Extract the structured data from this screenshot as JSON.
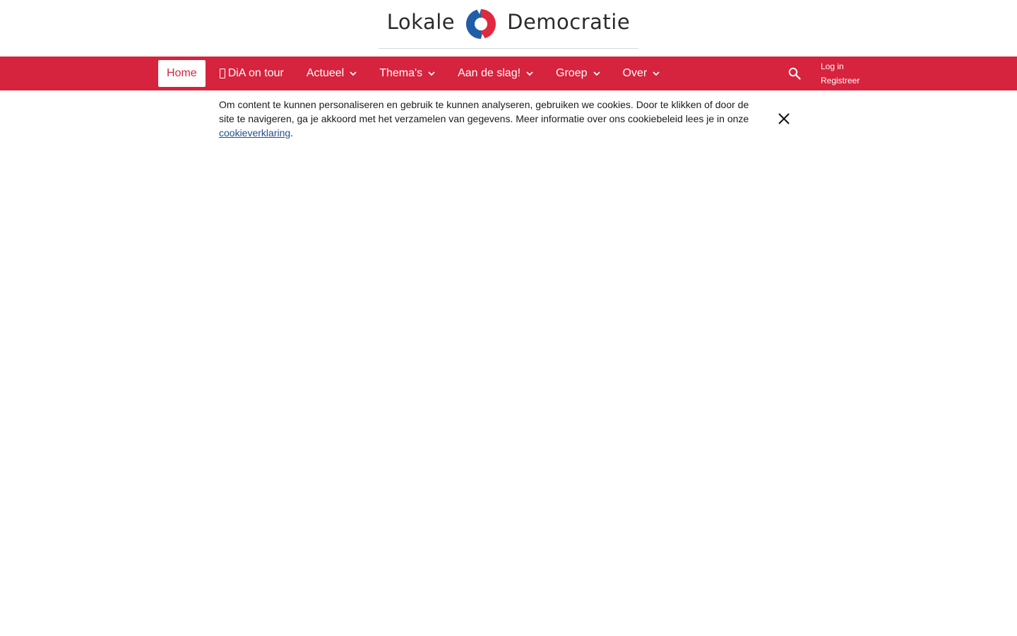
{
  "brand": {
    "name_left": "Lokale",
    "name_right": "Democratie",
    "colors": {
      "red": "#e0293f",
      "blue": "#1f5ea8",
      "text": "#2b2b2b"
    }
  },
  "nav": {
    "background": "#d6233e",
    "items": [
      {
        "label": "Home",
        "active": true,
        "has_dropdown": false
      },
      {
        "label": "DiA on tour",
        "icon": "tour-icon",
        "has_dropdown": false
      },
      {
        "label": "Actueel",
        "has_dropdown": true
      },
      {
        "label": "Thema's",
        "has_dropdown": true
      },
      {
        "label": "Aan de slag!",
        "has_dropdown": true
      },
      {
        "label": "Groep",
        "has_dropdown": true
      },
      {
        "label": "Over",
        "has_dropdown": true
      }
    ],
    "search_icon": "search-icon",
    "login_label": "Log in",
    "register_label": "Registreer"
  },
  "cookie_bar": {
    "text": "Om content te kunnen personaliseren en gebruik te kunnen analyseren, gebruiken we cookies. Door te klikken of door de site te navigeren, ga je akkoord met het verzamelen van gegevens. Meer informatie over ons cookiebeleid lees je in onze ",
    "link_label": "cookieverklaring",
    "suffix": ".",
    "close_icon": "close-icon"
  }
}
